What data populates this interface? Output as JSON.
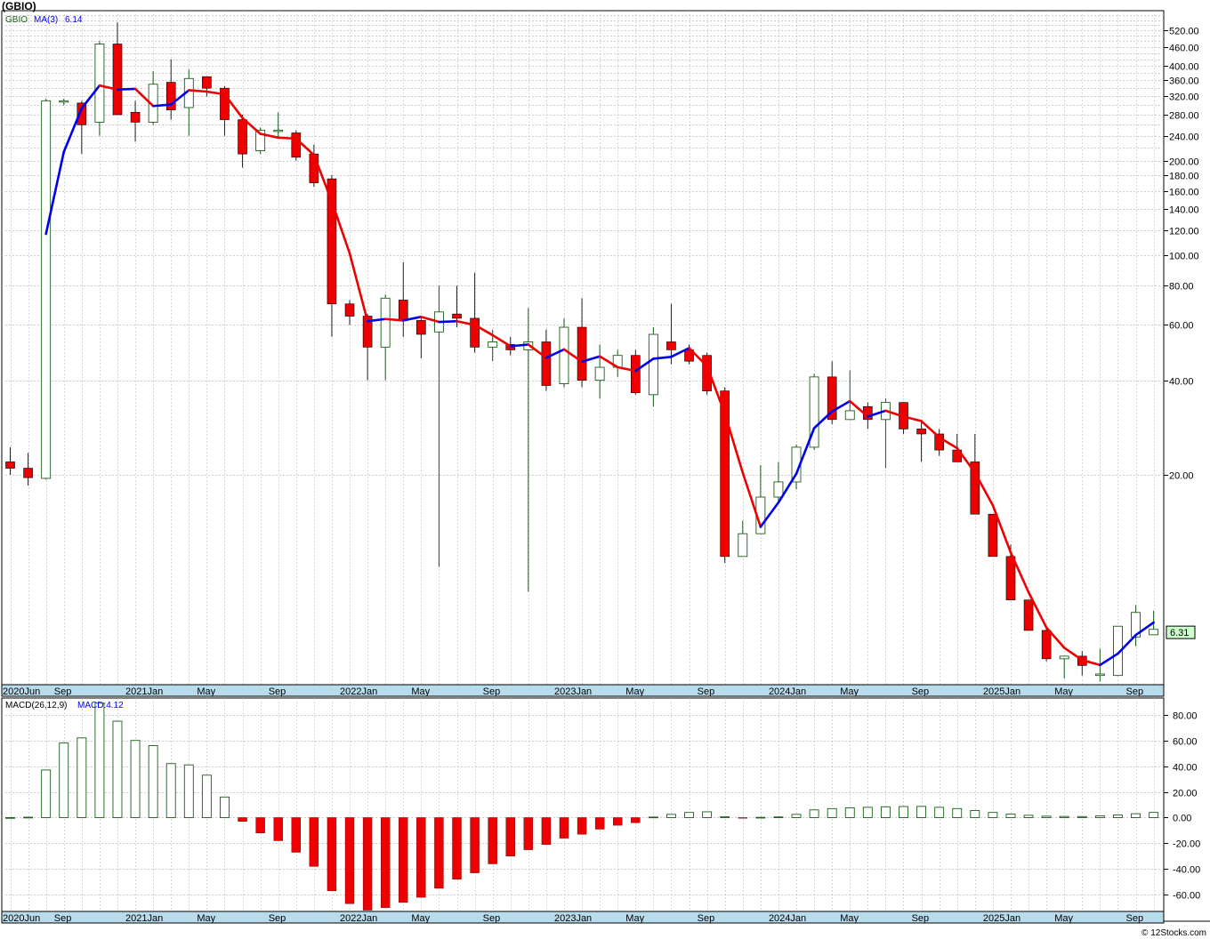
{
  "header": {
    "ticker_title": "(GBIO)"
  },
  "watermark": "© 12Stocks.com",
  "colors": {
    "up_candle_stroke": "#1a5e1a",
    "down_candle_fill": "#ee0000",
    "ma_up": "#0000ee",
    "ma_down": "#ee0000",
    "grid": "#bdbdbd",
    "axis_band": "#b9dced",
    "macd_up_stroke": "#1a5e1a",
    "macd_down_fill": "#ee0000",
    "last_price_box": "#ccffcc"
  },
  "chart_data": [
    {
      "type": "candlestick",
      "scale": "log",
      "ylim": [
        4.3,
        600
      ],
      "legend": {
        "symbol": "GBIO",
        "ma_label": "MA(3)",
        "ma_value": "6.14"
      },
      "last_price_label": "6.31",
      "y_ticks": [
        "520.00",
        "460.00",
        "400.00",
        "360.00",
        "320.00",
        "280.00",
        "240.00",
        "200.00",
        "180.00",
        "160.00",
        "140.00",
        "120.00",
        "100.00",
        "80.00",
        "60.00",
        "40.00",
        "20.00"
      ],
      "x_labels": [
        "2020Jun",
        "Sep",
        "2021Jan",
        "May",
        "Sep",
        "2022Jan",
        "May",
        "Sep",
        "2023Jan",
        "May",
        "Sep",
        "2024Jan",
        "May",
        "Sep",
        "2025Jan",
        "May",
        "Sep"
      ],
      "x_label_index": [
        0,
        3,
        7,
        11,
        15,
        19,
        23,
        27,
        31,
        35,
        39,
        43,
        47,
        51,
        55,
        59,
        63
      ],
      "months": [
        "2020-06",
        "2020-07",
        "2020-08",
        "2020-09",
        "2020-10",
        "2020-11",
        "2020-12",
        "2021-01",
        "2021-02",
        "2021-03",
        "2021-04",
        "2021-05",
        "2021-06",
        "2021-07",
        "2021-08",
        "2021-09",
        "2021-10",
        "2021-11",
        "2021-12",
        "2022-01",
        "2022-02",
        "2022-03",
        "2022-04",
        "2022-05",
        "2022-06",
        "2022-07",
        "2022-08",
        "2022-09",
        "2022-10",
        "2022-11",
        "2022-12",
        "2023-01",
        "2023-02",
        "2023-03",
        "2023-04",
        "2023-05",
        "2023-06",
        "2023-07",
        "2023-08",
        "2023-09",
        "2023-10",
        "2023-11",
        "2023-12",
        "2024-01",
        "2024-02",
        "2024-03",
        "2024-04",
        "2024-05",
        "2024-06",
        "2024-07",
        "2024-08",
        "2024-09",
        "2024-10",
        "2024-11",
        "2024-12",
        "2025-01",
        "2025-02",
        "2025-03",
        "2025-04",
        "2025-05",
        "2025-06",
        "2025-07",
        "2025-08",
        "2025-09",
        "2025-10"
      ],
      "ohlc": [
        [
          22,
          24.5,
          20,
          21
        ],
        [
          21,
          23.5,
          18.5,
          19.6
        ],
        [
          19.5,
          315,
          19.3,
          310
        ],
        [
          310,
          315,
          300,
          310
        ],
        [
          305,
          310,
          210,
          260
        ],
        [
          265,
          480,
          240,
          470
        ],
        [
          470,
          550,
          280,
          280
        ],
        [
          285,
          310,
          230,
          265
        ],
        [
          265,
          385,
          260,
          350
        ],
        [
          355,
          420,
          270,
          290
        ],
        [
          295,
          390,
          240,
          365
        ],
        [
          370,
          370,
          320,
          340
        ],
        [
          340,
          345,
          240,
          270
        ],
        [
          270,
          280,
          190,
          210
        ],
        [
          215,
          255,
          210,
          250
        ],
        [
          250,
          285,
          235,
          250
        ],
        [
          245,
          250,
          200,
          205
        ],
        [
          210,
          225,
          165,
          170
        ],
        [
          175,
          180,
          55,
          70
        ],
        [
          70,
          72,
          60,
          64
        ],
        [
          64,
          65,
          40,
          51
        ],
        [
          51,
          75,
          40,
          73
        ],
        [
          72,
          95,
          55,
          62
        ],
        [
          62,
          64,
          47,
          56
        ],
        [
          57,
          80,
          10.2,
          66
        ],
        [
          65,
          80,
          59,
          63
        ],
        [
          63,
          88,
          49,
          51
        ],
        [
          51,
          58,
          46,
          53
        ],
        [
          52,
          55,
          48,
          50
        ],
        [
          50,
          68,
          8.5,
          53
        ],
        [
          53,
          58,
          37,
          38.5
        ],
        [
          39,
          63,
          38,
          59
        ],
        [
          59,
          73,
          38,
          40
        ],
        [
          40,
          52,
          35,
          44
        ],
        [
          44,
          50,
          41,
          48
        ],
        [
          48,
          50,
          36,
          36.5
        ],
        [
          36,
          59,
          33,
          56
        ],
        [
          53,
          70,
          45,
          50
        ],
        [
          50,
          52,
          45,
          46
        ],
        [
          48,
          49,
          36,
          37
        ],
        [
          37,
          38,
          10.5,
          11
        ],
        [
          11,
          14.3,
          11,
          13
        ],
        [
          13,
          21.5,
          13,
          17
        ],
        [
          17,
          22,
          16.5,
          19
        ],
        [
          19,
          25,
          18,
          24.5
        ],
        [
          24.5,
          42,
          24,
          41
        ],
        [
          41,
          46,
          29,
          30
        ],
        [
          30,
          43,
          30,
          32
        ],
        [
          33,
          34,
          28,
          30
        ],
        [
          30,
          35,
          21,
          34
        ],
        [
          34,
          34,
          27,
          28
        ],
        [
          28,
          30,
          22,
          27
        ],
        [
          27,
          28,
          23,
          24
        ],
        [
          24,
          27,
          22,
          22
        ],
        [
          22,
          27,
          15,
          15
        ],
        [
          15,
          15,
          11,
          11
        ],
        [
          11,
          12,
          8,
          8
        ],
        [
          8,
          8,
          6.4,
          6.4
        ],
        [
          6.4,
          6.5,
          5.1,
          5.2
        ],
        [
          5.2,
          5.3,
          4.5,
          5.3
        ],
        [
          5.3,
          5.5,
          4.6,
          4.95
        ],
        [
          4.6,
          5.6,
          4.4,
          4.65
        ],
        [
          4.6,
          6.6,
          4.6,
          6.6
        ],
        [
          6.1,
          7.7,
          5.7,
          7.3
        ],
        [
          6.2,
          7.4,
          6.2,
          6.45
        ]
      ]
    },
    {
      "type": "bar",
      "legend": {
        "label": "MACD(26,12,9)",
        "value_label": "MACD:4.12"
      },
      "ylim": [
        -73,
        93
      ],
      "y_ticks": [
        "80.00",
        "60.00",
        "40.00",
        "20.00",
        "0.00",
        "-20.00",
        "-40.00",
        "-60.00"
      ],
      "y_tick_values": [
        80,
        60,
        40,
        20,
        0,
        -20,
        -40,
        -60
      ],
      "values": [
        0,
        0.3,
        37,
        58,
        62,
        89,
        75,
        60,
        56,
        42,
        41,
        33,
        16,
        -3,
        -12,
        -18,
        -27,
        -38,
        -57,
        -67,
        -72,
        -70,
        -66,
        -62,
        -55,
        -48,
        -43,
        -36,
        -30,
        -25,
        -21,
        -16,
        -13,
        -9,
        -6,
        -4,
        0.4,
        2.5,
        4,
        4.5,
        0.6,
        -0.3,
        0.2,
        0.5,
        2.5,
        6,
        7,
        7.6,
        8,
        8.4,
        8.6,
        8.7,
        8,
        7,
        5.5,
        4,
        2.7,
        1.8,
        1.1,
        0.9,
        0.8,
        1.3,
        2,
        3,
        4
      ],
      "x_labels": [
        "2020Jun",
        "Sep",
        "2021Jan",
        "May",
        "Sep",
        "2022Jan",
        "May",
        "Sep",
        "2023Jan",
        "May",
        "Sep",
        "2024Jan",
        "May",
        "Sep",
        "2025Jan",
        "May",
        "Sep"
      ]
    }
  ]
}
